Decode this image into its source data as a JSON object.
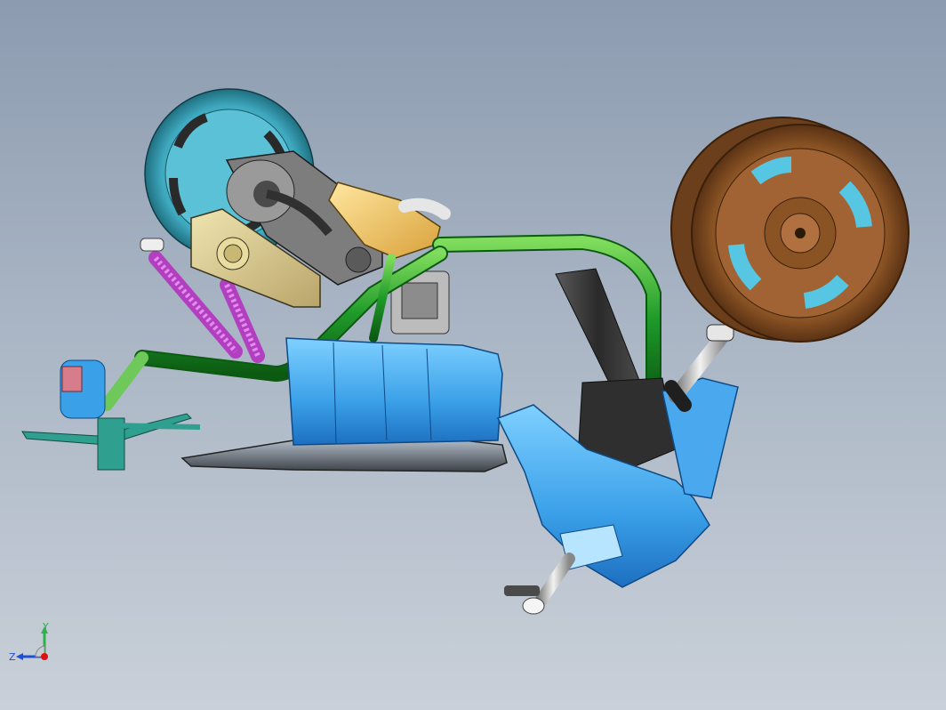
{
  "viewport": {
    "background_top": "#8c9bb0",
    "background_bottom": "#c9d0d9"
  },
  "triad": {
    "x_label": "",
    "y_label": "Y",
    "z_label": "Z",
    "colors": {
      "x": "#e01010",
      "y": "#2bb24c",
      "z": "#1f4fd6"
    }
  },
  "model": {
    "part_colors": {
      "frame": "#1f9a2a",
      "front_tire": "#8a5324",
      "rear_tire": "#3fa9bf",
      "body_shell": "#3aa0e8",
      "shocks": "#c23fc8",
      "engine_cover": "#f2c555",
      "seat_floor": "#4a4a4a",
      "footrest": "#2f9f8f"
    }
  }
}
